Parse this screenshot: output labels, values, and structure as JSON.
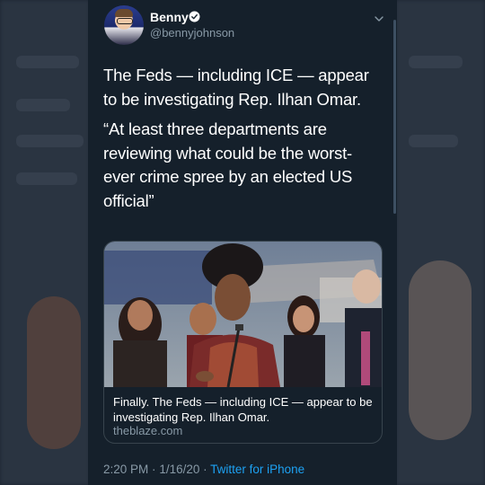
{
  "user": {
    "name": "Benny",
    "handle": "@bennyjohnson"
  },
  "tweet": {
    "paragraph_1": "The Feds — including ICE — appear to be investigating Rep. Ilhan Omar.",
    "paragraph_2": "“At least three departments are reviewing what could be the worst-ever crime spree by an elected US official”"
  },
  "link_card": {
    "title": "Finally. The Feds — including ICE — appear to be investigating Rep. Ilhan Omar.",
    "domain": "theblaze.com"
  },
  "meta": {
    "time": "2:20 PM",
    "separator": "·",
    "date": "1/16/20",
    "source": "Twitter for iPhone"
  },
  "colors": {
    "background": "#15202b",
    "text": "#ffffff",
    "secondary_text": "#8899a6",
    "link_accent": "#1da1f2"
  },
  "icons": {
    "verified": "verified-badge-icon",
    "menu": "chevron-down-icon"
  }
}
